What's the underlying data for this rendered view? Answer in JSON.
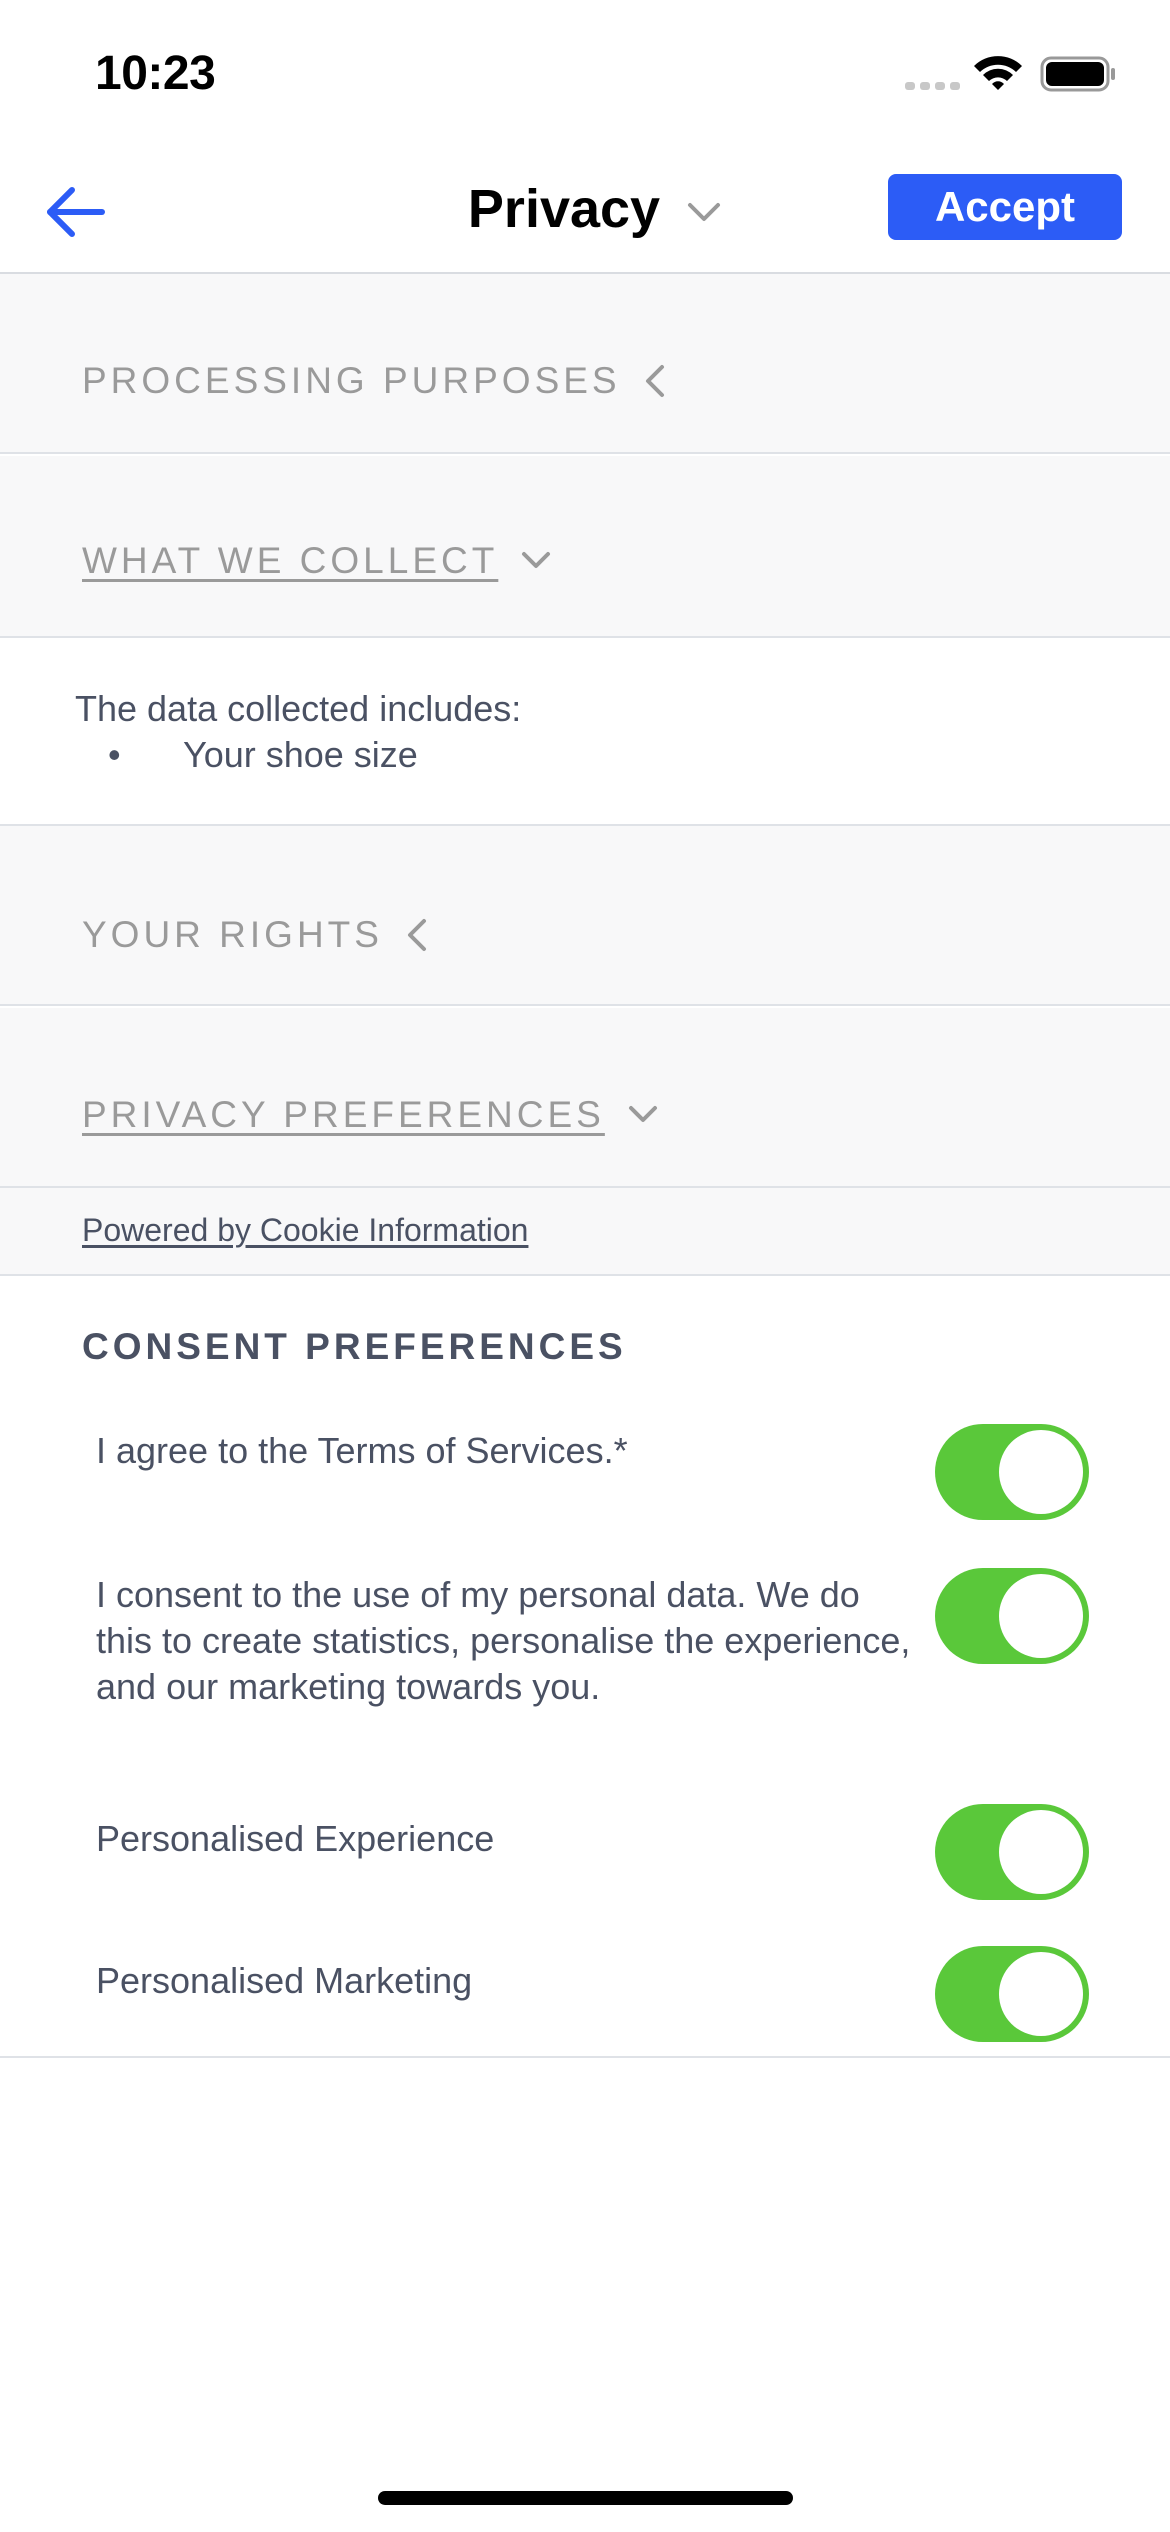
{
  "status_bar": {
    "time": "10:23",
    "signal_icon": "cellular-signal-icon",
    "wifi_icon": "wifi-icon",
    "battery_icon": "battery-full-icon"
  },
  "nav": {
    "back_icon": "arrow-left-icon",
    "title": "Privacy",
    "title_chevron_icon": "chevron-down-icon",
    "accept_label": "Accept",
    "accent_color": "#2c5cf6"
  },
  "sections": [
    {
      "label": "PROCESSING PURPOSES",
      "state": "collapsed",
      "icon": "chevron-left-icon"
    },
    {
      "label": "WHAT WE COLLECT",
      "state": "expanded",
      "icon": "chevron-down-icon"
    },
    {
      "label": "YOUR RIGHTS",
      "state": "collapsed",
      "icon": "chevron-left-icon"
    },
    {
      "label": "PRIVACY PREFERENCES",
      "state": "expanded",
      "icon": "chevron-down-icon"
    }
  ],
  "collect": {
    "intro": "The data collected includes:",
    "bullet": "•",
    "items": [
      "Your shoe size"
    ]
  },
  "powered_by": "Powered by Cookie Information",
  "consent": {
    "heading": "CONSENT PREFERENCES",
    "toggle_color": "#5ac83a",
    "items": [
      {
        "label": "I agree to the Terms of Services.*",
        "checked": true
      },
      {
        "label": "I consent to the use of my personal data. We do this to create statistics, personalise the experience, and our marketing towards you.",
        "checked": true
      },
      {
        "label": "Personalised Experience",
        "checked": true
      },
      {
        "label": "Personalised Marketing",
        "checked": true
      }
    ]
  }
}
